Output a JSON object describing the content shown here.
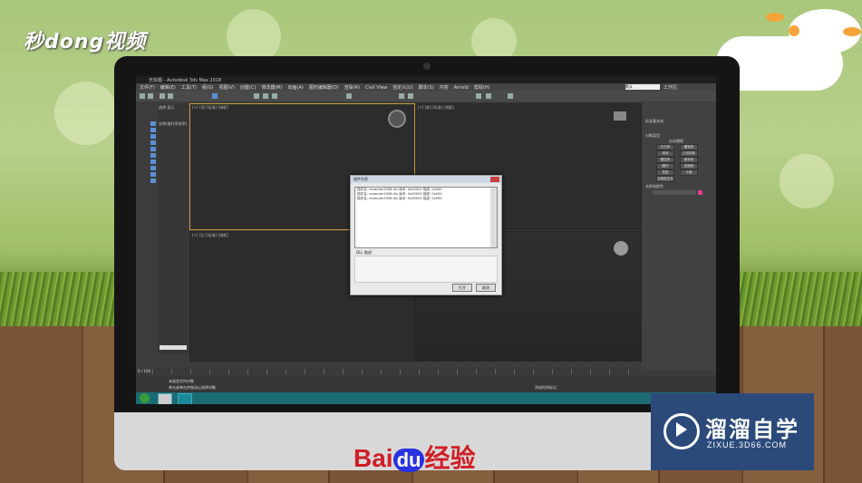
{
  "brand_top": {
    "text": "秒dong视频"
  },
  "app": {
    "title": "无标题 - Autodesk 3ds Max 2018",
    "menus": [
      "文件(F)",
      "编辑(E)",
      "工具(T)",
      "组(G)",
      "视图(V)",
      "创建(C)",
      "修改器(M)",
      "动画(A)",
      "图形编辑器(D)",
      "渲染(R)",
      "Civil View",
      "自定义(U)",
      "脚本(S)",
      "内容",
      "Arnold",
      "帮助(H)"
    ],
    "workspace_label": "工作区:",
    "workspace_value": "默认",
    "explorer_tabs": [
      "选择",
      "显示"
    ],
    "explorer_header": "名称(按升序排序)",
    "viewports": {
      "top_left": "[+] [顶] [标准] [线框]",
      "top_right": "[+] [前] [标准] [线框]",
      "bottom_left": "[+] [左] [标准] [线框]",
      "bottom_right": ""
    },
    "command_panel": {
      "section_object_type": "对象类型",
      "autogrid": "自动栅格",
      "buttons": [
        "长方体",
        "圆锥体",
        "球体",
        "几何球体",
        "圆柱体",
        "管状体",
        "圆环",
        "四棱锥",
        "茶壶",
        "平面",
        "加强型文本",
        ""
      ],
      "section_name_color": "名称和颜色",
      "category": "标准基本体"
    },
    "status": {
      "line1": "未选定任何对象",
      "line2": "单击或单击并拖动以选择对象",
      "frame": "0 / 100",
      "add_time_tag": "添加时间标记"
    }
  },
  "dialog": {
    "title": "插件信息",
    "list_rows": [
      "插件名: revander2008.dlu   版本: 0x00001   描述: 0x000",
      "插件名: revander2008.dlu   版本: 0x00001   描述: 0x000",
      "插件名: revander2008.dlu   版本: 0x00001   描述: 0x000"
    ],
    "description_label": "DLL 描述:",
    "ok_label": "打开",
    "cancel_label": "取消"
  },
  "footer_brand": {
    "bai": "Bai",
    "du": "du",
    "jingyan": "经验"
  },
  "watermark": {
    "title": "溜溜自学",
    "url": "ZIXUE.3D66.COM"
  }
}
